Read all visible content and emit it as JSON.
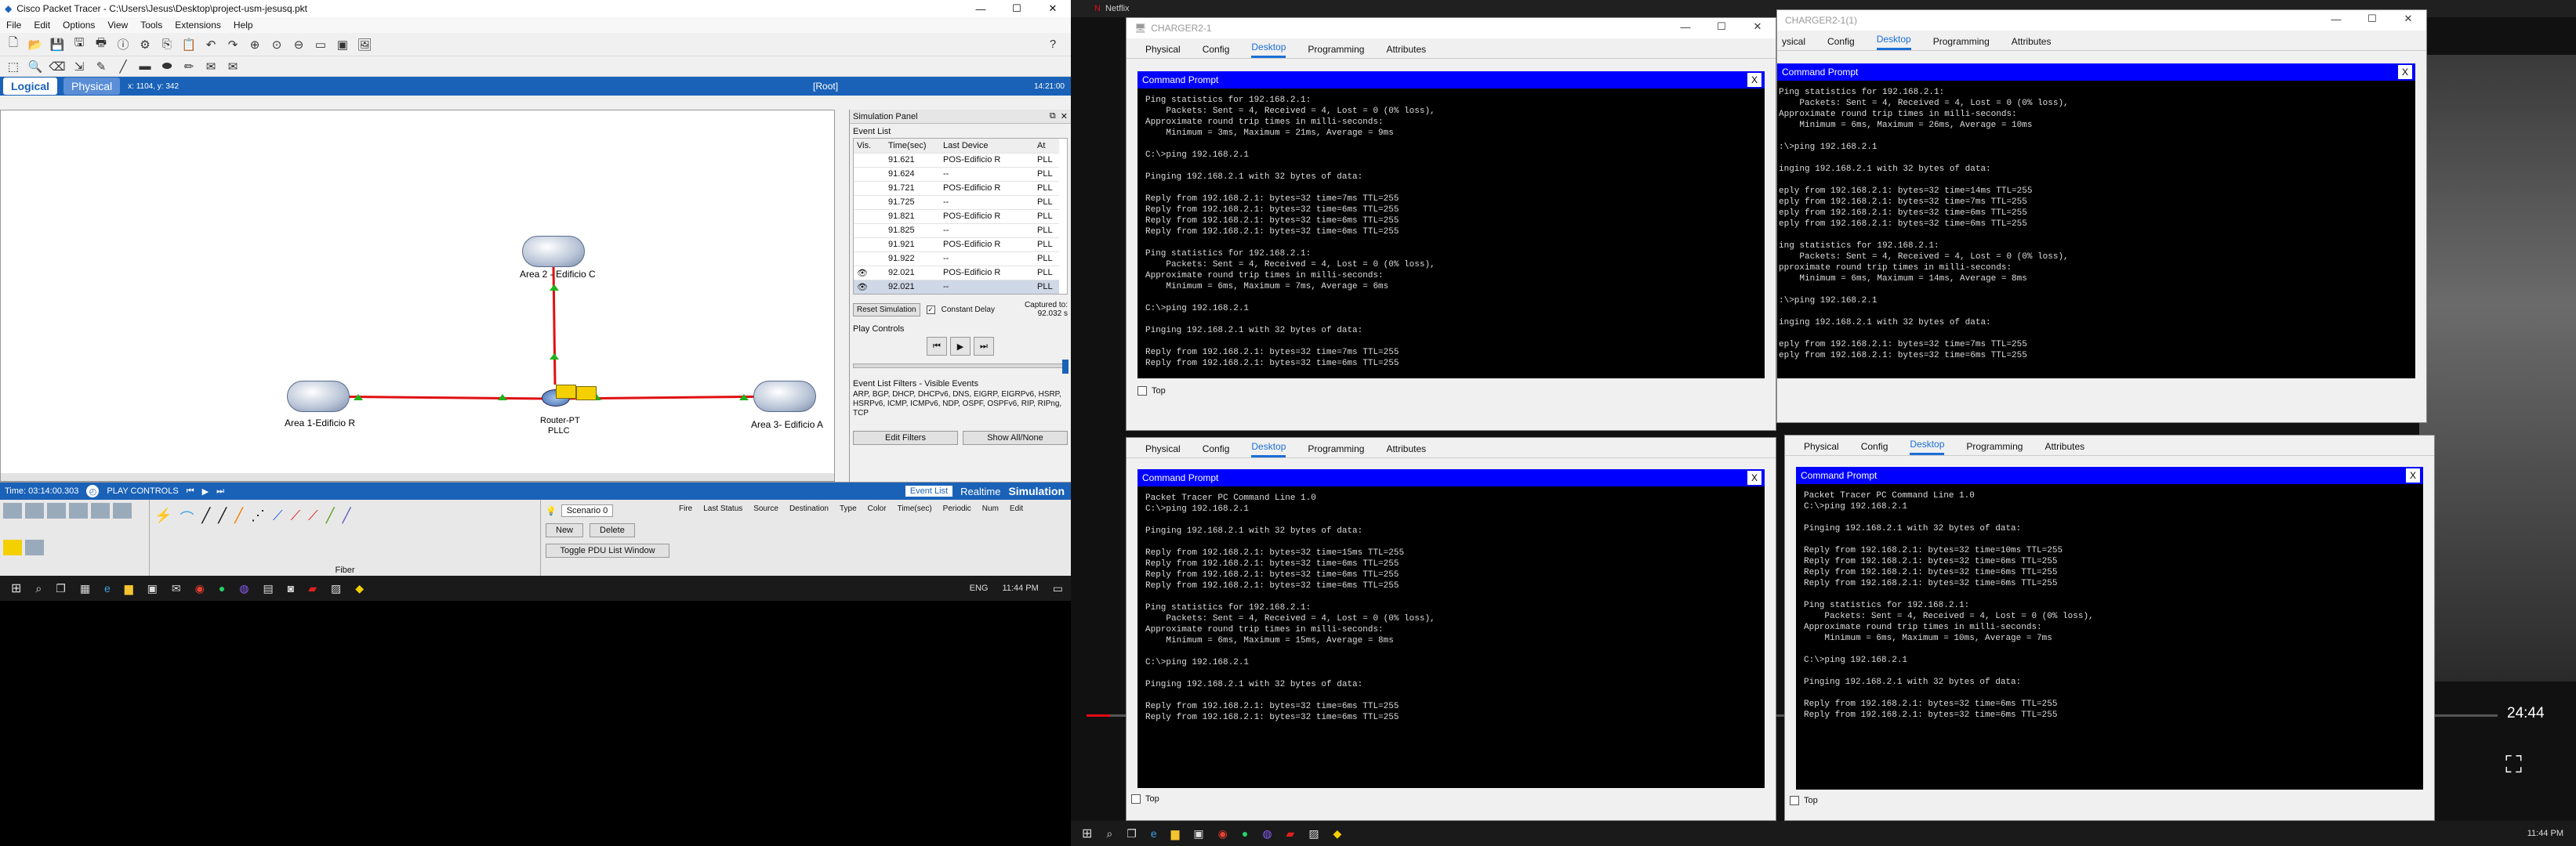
{
  "pt": {
    "title": "Cisco Packet Tracer - C:\\Users\\Jesus\\Desktop\\project-usm-jesusq.pkt",
    "menu": [
      "File",
      "Edit",
      "Options",
      "View",
      "Tools",
      "Extensions",
      "Help"
    ],
    "logical": "Logical",
    "physical": "Physical",
    "coords": "x: 1104, y: 342",
    "root": "[Root]",
    "clock": "14:21:00",
    "devices": {
      "area2": "Area 2 - Edificio C",
      "area1": "Area 1-Edificio R",
      "area3": "Area 3- Edificio A",
      "router": "Router-PT",
      "router2": "PLLC"
    },
    "sim": {
      "title": "Simulation Panel",
      "event_list": "Event List",
      "cols": [
        "Vis.",
        "Time(sec)",
        "Last Device",
        "At"
      ],
      "rows": [
        {
          "t": "91.621",
          "d": "POS-Edificio R",
          "a": "PLL"
        },
        {
          "t": "91.624",
          "d": "--",
          "a": "PLL"
        },
        {
          "t": "91.721",
          "d": "POS-Edificio R",
          "a": "PLL"
        },
        {
          "t": "91.725",
          "d": "--",
          "a": "PLL"
        },
        {
          "t": "91.821",
          "d": "POS-Edificio R",
          "a": "PLL"
        },
        {
          "t": "91.825",
          "d": "--",
          "a": "PLL"
        },
        {
          "t": "91.921",
          "d": "POS-Edificio R",
          "a": "PLL"
        },
        {
          "t": "91.922",
          "d": "--",
          "a": "PLL"
        },
        {
          "t": "92.021",
          "d": "POS-Edificio R",
          "a": "PLL"
        },
        {
          "t": "92.021",
          "d": "--",
          "a": "PLL"
        }
      ],
      "reset": "Reset Simulation",
      "constant": "Constant Delay",
      "captured": "Captured to:",
      "captured_val": "92.032 s",
      "play": "Play Controls",
      "filters_title": "Event List Filters - Visible Events",
      "filters": "ARP, BGP, DHCP, DHCPv6, DNS, EIGRP, EIGRPv6, HSRP, HSRPv6, ICMP, ICMPv6, NDP, OSPF, OSPFv6, RIP, RIPng, TCP",
      "edit_filters": "Edit Filters",
      "show_all": "Show All/None"
    },
    "statusbar": {
      "time": "Time: 03:14:00.303",
      "play": "PLAY CONTROLS",
      "event_list": "Event List",
      "realtime": "Realtime",
      "simulation": "Simulation"
    },
    "bottom": {
      "scenario": "Scenario 0",
      "new": "New",
      "delete": "Delete",
      "toggle": "Toggle PDU List Window",
      "fiber": "Fiber",
      "cols": [
        "Fire",
        "Last Status",
        "Source",
        "Destination",
        "Type",
        "Color",
        "Time(sec)",
        "Periodic",
        "Num",
        "Edit"
      ]
    }
  },
  "taskbar": {
    "lang": "ENG",
    "time": "11:44 PM",
    "time2": "11:44 PM"
  },
  "netflix": {
    "tab": "Netflix",
    "time": "24:44"
  },
  "pc1": {
    "title": "CHARGER2-1",
    "tabs": [
      "Physical",
      "Config",
      "Desktop",
      "Programming",
      "Attributes"
    ],
    "cmd": "Command Prompt",
    "text": "Ping statistics for 192.168.2.1:\n    Packets: Sent = 4, Received = 4, Lost = 0 (0% loss),\nApproximate round trip times in milli-seconds:\n    Minimum = 3ms, Maximum = 21ms, Average = 9ms\n\nC:\\>ping 192.168.2.1\n\nPinging 192.168.2.1 with 32 bytes of data:\n\nReply from 192.168.2.1: bytes=32 time=7ms TTL=255\nReply from 192.168.2.1: bytes=32 time=6ms TTL=255\nReply from 192.168.2.1: bytes=32 time=6ms TTL=255\nReply from 192.168.2.1: bytes=32 time=6ms TTL=255\n\nPing statistics for 192.168.2.1:\n    Packets: Sent = 4, Received = 4, Lost = 0 (0% loss),\nApproximate round trip times in milli-seconds:\n    Minimum = 6ms, Maximum = 7ms, Average = 6ms\n\nC:\\>ping 192.168.2.1\n\nPinging 192.168.2.1 with 32 bytes of data:\n\nReply from 192.168.2.1: bytes=32 time=7ms TTL=255\nReply from 192.168.2.1: bytes=32 time=6ms TTL=255",
    "top": "Top"
  },
  "pc2": {
    "title": "CHARGER2-1(1)",
    "tabs": [
      "ysical",
      "Config",
      "Desktop",
      "Programming",
      "Attributes"
    ],
    "cmd": "Command Prompt",
    "text": "Ping statistics for 192.168.2.1:\n    Packets: Sent = 4, Received = 4, Lost = 0 (0% loss),\nApproximate round trip times in milli-seconds:\n    Minimum = 6ms, Maximum = 26ms, Average = 10ms\n\n:\\>ping 192.168.2.1\n\ninging 192.168.2.1 with 32 bytes of data:\n\neply from 192.168.2.1: bytes=32 time=14ms TTL=255\neply from 192.168.2.1: bytes=32 time=7ms TTL=255\neply from 192.168.2.1: bytes=32 time=6ms TTL=255\neply from 192.168.2.1: bytes=32 time=6ms TTL=255\n\ning statistics for 192.168.2.1:\n    Packets: Sent = 4, Received = 4, Lost = 0 (0% loss),\npproximate round trip times in milli-seconds:\n    Minimum = 6ms, Maximum = 14ms, Average = 8ms\n\n:\\>ping 192.168.2.1\n\ninging 192.168.2.1 with 32 bytes of data:\n\neply from 192.168.2.1: bytes=32 time=7ms TTL=255\neply from 192.168.2.1: bytes=32 time=6ms TTL=255",
    "top": "Top"
  },
  "pc3": {
    "tabs": [
      "Physical",
      "Config",
      "Desktop",
      "Programming",
      "Attributes"
    ],
    "cmd": "Command Prompt",
    "text": "Packet Tracer PC Command Line 1.0\nC:\\>ping 192.168.2.1\n\nPinging 192.168.2.1 with 32 bytes of data:\n\nReply from 192.168.2.1: bytes=32 time=15ms TTL=255\nReply from 192.168.2.1: bytes=32 time=6ms TTL=255\nReply from 192.168.2.1: bytes=32 time=6ms TTL=255\nReply from 192.168.2.1: bytes=32 time=6ms TTL=255\n\nPing statistics for 192.168.2.1:\n    Packets: Sent = 4, Received = 4, Lost = 0 (0% loss),\nApproximate round trip times in milli-seconds:\n    Minimum = 6ms, Maximum = 15ms, Average = 8ms\n\nC:\\>ping 192.168.2.1\n\nPinging 192.168.2.1 with 32 bytes of data:\n\nReply from 192.168.2.1: bytes=32 time=6ms TTL=255\nReply from 192.168.2.1: bytes=32 time=6ms TTL=255",
    "top": "Top"
  },
  "pc4": {
    "tabs": [
      "Physical",
      "Config",
      "Desktop",
      "Programming",
      "Attributes"
    ],
    "cmd": "Command Prompt",
    "text": "Packet Tracer PC Command Line 1.0\nC:\\>ping 192.168.2.1\n\nPinging 192.168.2.1 with 32 bytes of data:\n\nReply from 192.168.2.1: bytes=32 time=10ms TTL=255\nReply from 192.168.2.1: bytes=32 time=6ms TTL=255\nReply from 192.168.2.1: bytes=32 time=6ms TTL=255\nReply from 192.168.2.1: bytes=32 time=6ms TTL=255\n\nPing statistics for 192.168.2.1:\n    Packets: Sent = 4, Received = 4, Lost = 0 (0% loss),\nApproximate round trip times in milli-seconds:\n    Minimum = 6ms, Maximum = 10ms, Average = 7ms\n\nC:\\>ping 192.168.2.1\n\nPinging 192.168.2.1 with 32 bytes of data:\n\nReply from 192.168.2.1: bytes=32 time=6ms TTL=255\nReply from 192.168.2.1: bytes=32 time=6ms TTL=255",
    "top": "Top"
  }
}
